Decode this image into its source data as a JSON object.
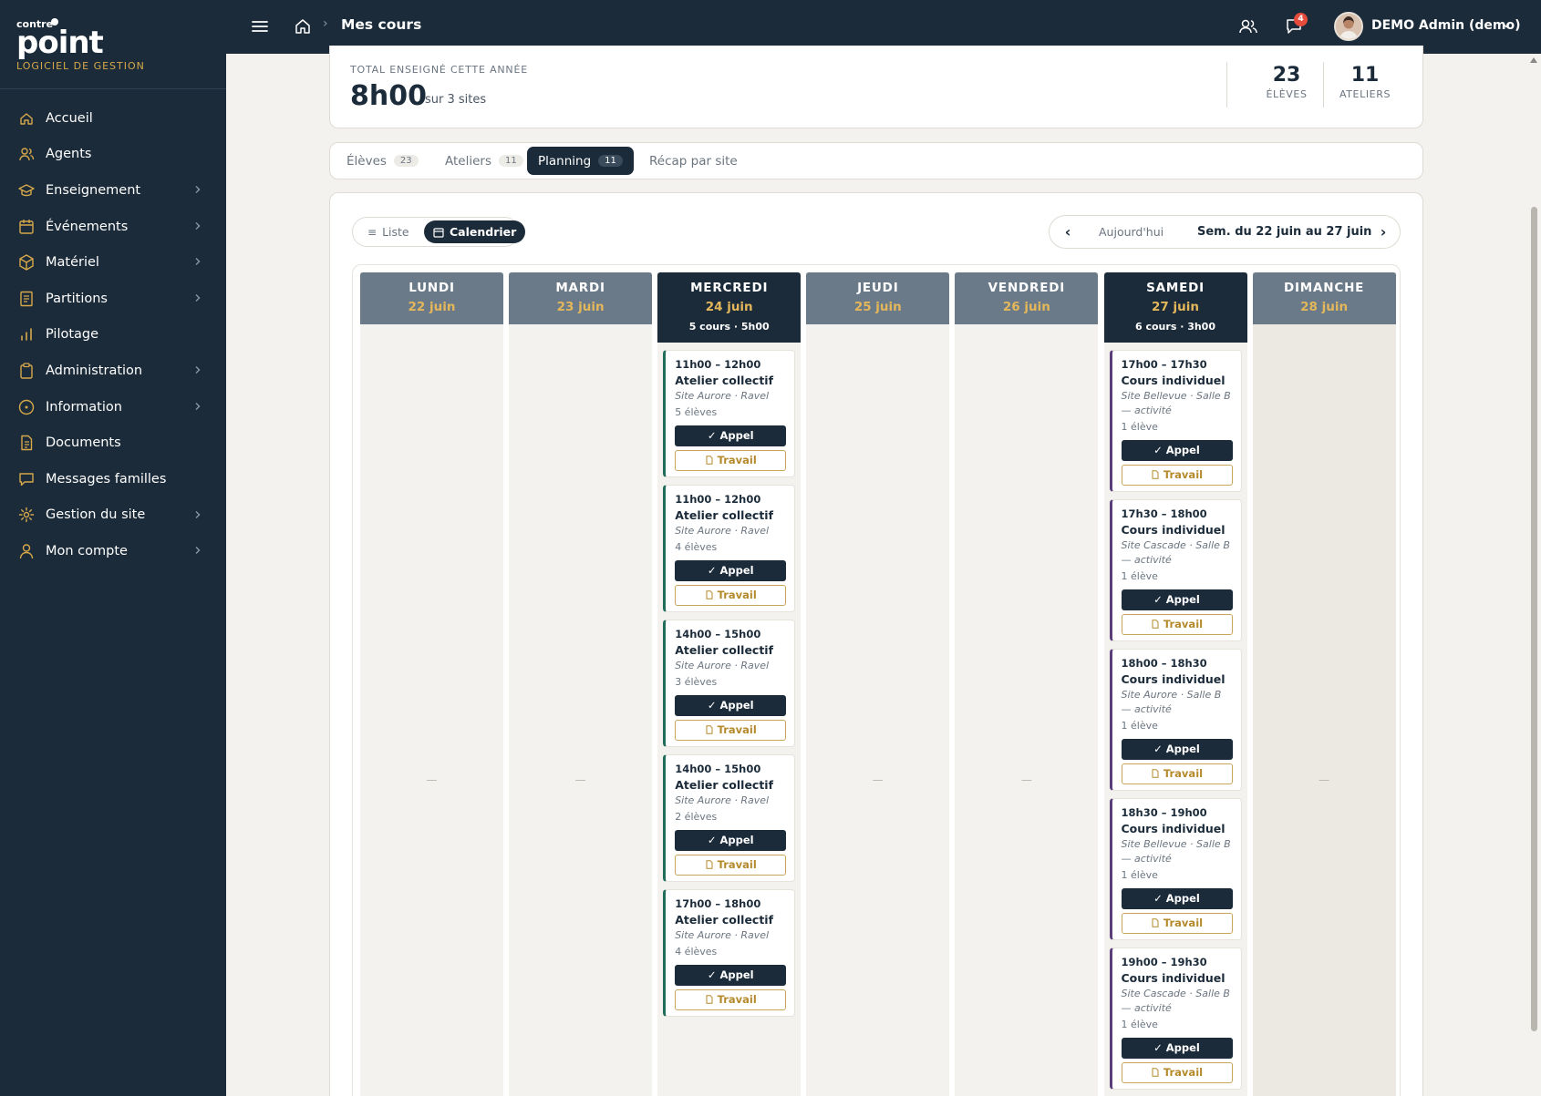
{
  "brand": {
    "small": "contre",
    "big": "point",
    "subtitle": "LOGICIEL DE GESTION"
  },
  "sidebar": {
    "items": [
      {
        "label": "Accueil",
        "icon": "home-icon",
        "chevron": false
      },
      {
        "label": "Agents",
        "icon": "users-icon",
        "chevron": false
      },
      {
        "label": "Enseignement",
        "icon": "graduation-cap-icon",
        "chevron": true
      },
      {
        "label": "Événements",
        "icon": "calendar-icon",
        "chevron": true
      },
      {
        "label": "Matériel",
        "icon": "box-icon",
        "chevron": true
      },
      {
        "label": "Partitions",
        "icon": "sheet-icon",
        "chevron": true
      },
      {
        "label": "Pilotage",
        "icon": "bar-chart-icon",
        "chevron": false
      },
      {
        "label": "Administration",
        "icon": "clipboard-icon",
        "chevron": true
      },
      {
        "label": "Information",
        "icon": "info-icon",
        "chevron": true
      },
      {
        "label": "Documents",
        "icon": "document-icon",
        "chevron": false
      },
      {
        "label": "Messages familles",
        "icon": "message-icon",
        "chevron": false
      },
      {
        "label": "Gestion du site",
        "icon": "gear-icon",
        "chevron": true
      },
      {
        "label": "Mon compte",
        "icon": "user-icon",
        "chevron": true
      }
    ]
  },
  "topbar": {
    "page_title": "Mes cours",
    "breadcrumb_sep": "›",
    "notif_count": "4",
    "user_name": "DEMO Admin (demo)"
  },
  "summary": {
    "label": "TOTAL ENSEIGNÉ CETTE ANNÉE",
    "value": "8h00",
    "sub": "sur 3 sites",
    "stats": [
      {
        "num": "23",
        "label": "ÉLÈVES"
      },
      {
        "num": "11",
        "label": "ATELIERS"
      }
    ]
  },
  "tabs": [
    {
      "label": "Élèves",
      "count": "23",
      "active": false
    },
    {
      "label": "Ateliers",
      "count": "11",
      "active": false
    },
    {
      "label": "Planning",
      "count": "11",
      "active": true
    },
    {
      "label": "Récap par site",
      "count": "",
      "active": false
    }
  ],
  "view_toggle": {
    "list": "Liste",
    "calendar": "Calendrier"
  },
  "week_nav": {
    "prev": "‹",
    "next": "›",
    "today": "Aujourd'hui",
    "range": "Sem. du 22 juin au 27 juin"
  },
  "days": [
    {
      "name": "LUNDI",
      "date": "22 juin",
      "summary": "",
      "weekend": false,
      "empty": "—",
      "events": []
    },
    {
      "name": "MARDI",
      "date": "23 juin",
      "summary": "",
      "weekend": false,
      "empty": "—",
      "events": []
    },
    {
      "name": "MERCREDI",
      "date": "24 juin",
      "summary": "5 cours · 5h00",
      "weekend": false,
      "empty": "",
      "events": [
        {
          "time": "11h00 – 12h00",
          "title": "Atelier collectif",
          "site": "Site Aurore · Ravel",
          "count": "5 élèves",
          "kind": "collectif"
        },
        {
          "time": "11h00 – 12h00",
          "title": "Atelier collectif",
          "site": "Site Aurore · Ravel",
          "count": "4 élèves",
          "kind": "collectif"
        },
        {
          "time": "14h00 – 15h00",
          "title": "Atelier collectif",
          "site": "Site Aurore · Ravel",
          "count": "3 élèves",
          "kind": "collectif"
        },
        {
          "time": "14h00 – 15h00",
          "title": "Atelier collectif",
          "site": "Site Aurore · Ravel",
          "count": "2 élèves",
          "kind": "collectif"
        },
        {
          "time": "17h00 – 18h00",
          "title": "Atelier collectif",
          "site": "Site Aurore · Ravel",
          "count": "4 élèves",
          "kind": "collectif"
        }
      ]
    },
    {
      "name": "JEUDI",
      "date": "25 juin",
      "summary": "",
      "weekend": false,
      "empty": "—",
      "events": []
    },
    {
      "name": "VENDREDI",
      "date": "26 juin",
      "summary": "",
      "weekend": false,
      "empty": "—",
      "events": []
    },
    {
      "name": "SAMEDI",
      "date": "27 juin",
      "summary": "6 cours · 3h00",
      "weekend": false,
      "empty": "",
      "events": [
        {
          "time": "17h00 – 17h30",
          "title": "Cours individuel",
          "site": "Site Bellevue · Salle B — activité",
          "count": "1 élève",
          "kind": "individuel"
        },
        {
          "time": "17h30 – 18h00",
          "title": "Cours individuel",
          "site": "Site Cascade · Salle B — activité",
          "count": "1 élève",
          "kind": "individuel"
        },
        {
          "time": "18h00 – 18h30",
          "title": "Cours individuel",
          "site": "Site Aurore · Salle B — activité",
          "count": "1 élève",
          "kind": "individuel"
        },
        {
          "time": "18h30 – 19h00",
          "title": "Cours individuel",
          "site": "Site Bellevue · Salle B — activité",
          "count": "1 élève",
          "kind": "individuel"
        },
        {
          "time": "19h00 – 19h30",
          "title": "Cours individuel",
          "site": "Site Cascade · Salle B — activité",
          "count": "1 élève",
          "kind": "individuel"
        }
      ]
    },
    {
      "name": "DIMANCHE",
      "date": "28 juin",
      "summary": "",
      "weekend": true,
      "empty": "—",
      "events": []
    }
  ],
  "event_buttons": {
    "appel": "✓ Appel",
    "travail": "Travail"
  },
  "colors": {
    "navy": "#1b2b3a",
    "gold": "#e3b75a",
    "green_accent": "#1f6d5a",
    "purple_accent": "#5b3d7a",
    "badge_red": "#e64b3c"
  }
}
